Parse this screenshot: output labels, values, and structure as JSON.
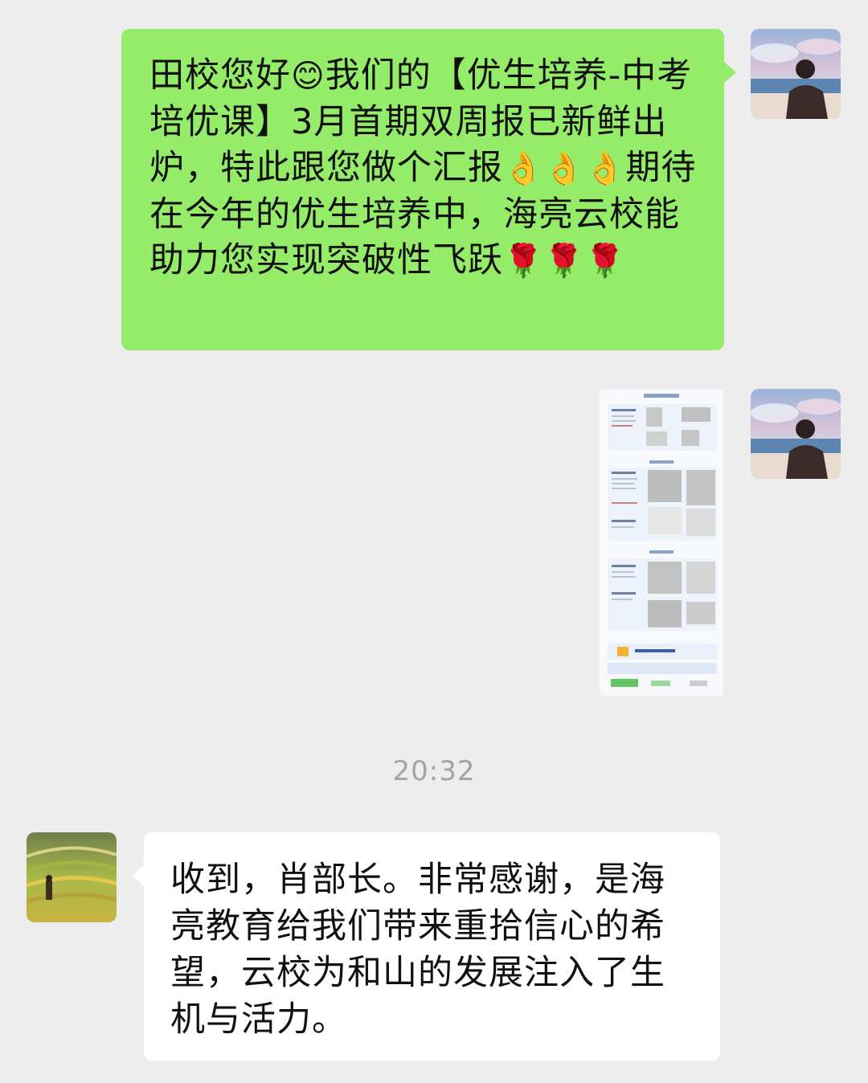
{
  "messages": [
    {
      "side": "right",
      "segments": [
        {
          "text": "田校您好"
        },
        {
          "emoji": "😊",
          "icon": "smiling-face-emoji"
        },
        {
          "text": "我们的【优生培养-中考培优课】3月首期双周报已新鲜出炉，特此跟您做个汇报"
        },
        {
          "emoji": "👌👌👌",
          "icon": "ok-hand-emoji"
        },
        {
          "text": "期待在今年的优生培养中，海亮云校能助力您实现突破性飞跃"
        },
        {
          "emoji": "🌹🌹🌹",
          "icon": "rose-emoji"
        }
      ]
    },
    {
      "side": "right",
      "type": "image",
      "icon": "report-document-thumbnail"
    }
  ],
  "timestamp": "20:32",
  "reply": {
    "side": "left",
    "text": "收到，肖部长。非常感谢，是海亮教育给我们带来重拾信心的希望，云校为和山的发展注入了生机与活力。"
  },
  "colors": {
    "background": "#ededed",
    "sent_bubble": "#95ec69",
    "received_bubble": "#ffffff",
    "timestamp": "#a3a3a3"
  }
}
